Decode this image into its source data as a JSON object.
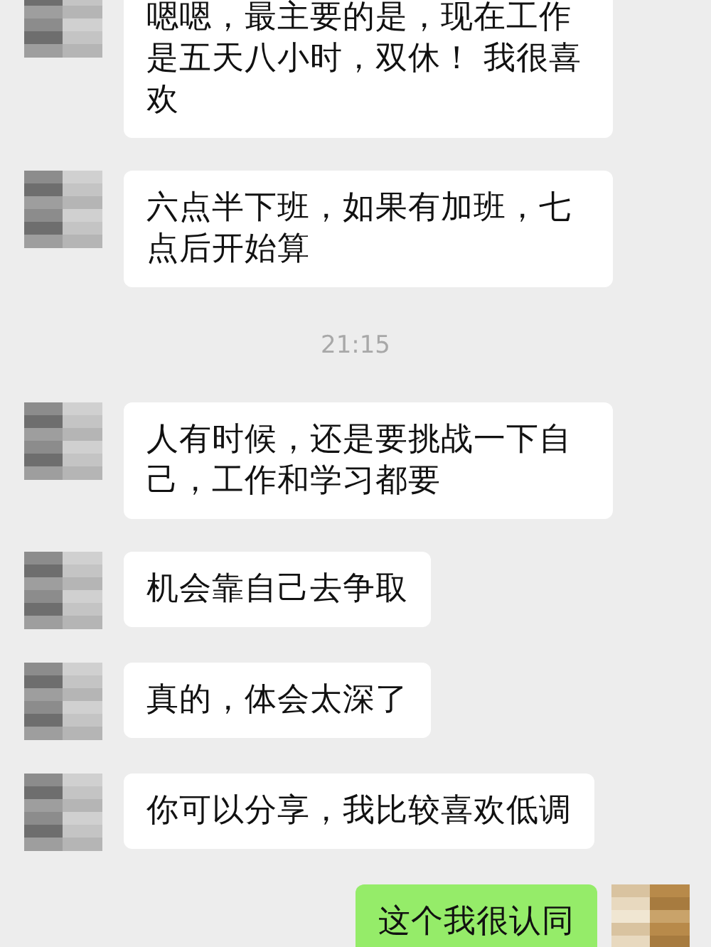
{
  "messages": [
    {
      "kind": "received",
      "text": "嗯嗯，最主要的是，现在工作是五天八小时，双休！ 我很喜欢"
    },
    {
      "kind": "received",
      "text": "六点半下班，如果有加班，七点后开始算"
    },
    {
      "kind": "time",
      "text": "21:15"
    },
    {
      "kind": "received",
      "text": "人有时候，还是要挑战一下自己，工作和学习都要"
    },
    {
      "kind": "received",
      "text": "机会靠自己去争取"
    },
    {
      "kind": "received",
      "text": "真的，体会太深了"
    },
    {
      "kind": "received",
      "text": "你可以分享，我比较喜欢低调"
    },
    {
      "kind": "sent",
      "text": "这个我很认同"
    }
  ]
}
